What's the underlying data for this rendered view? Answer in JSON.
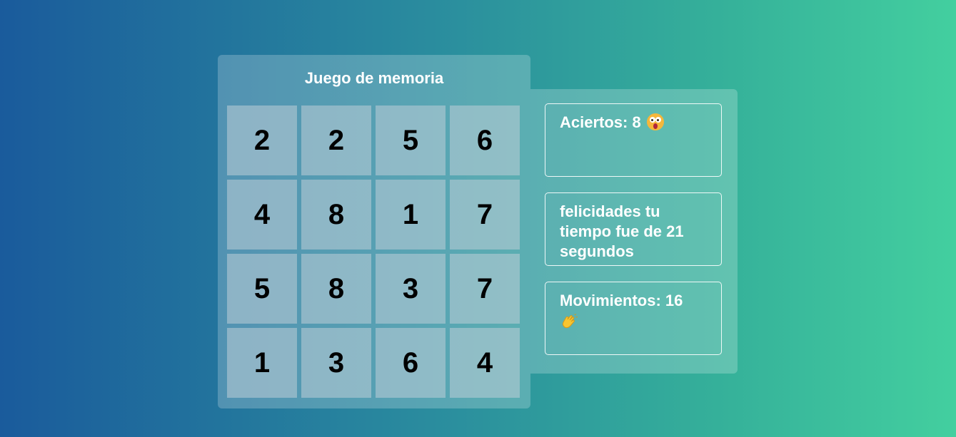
{
  "game": {
    "title": "Juego de memoria",
    "cards": [
      "2",
      "2",
      "5",
      "6",
      "4",
      "8",
      "1",
      "7",
      "5",
      "8",
      "3",
      "7",
      "1",
      "3",
      "6",
      "4"
    ]
  },
  "stats": {
    "aciertos_label": "Aciertos: 8",
    "aciertos_icon": "surprised-face-icon",
    "time_message": "felicidades tu tiempo fue de 21 segundos",
    "movimientos_label": "Movimientos: 16",
    "movimientos_icon": "clapping-hands-icon"
  }
}
